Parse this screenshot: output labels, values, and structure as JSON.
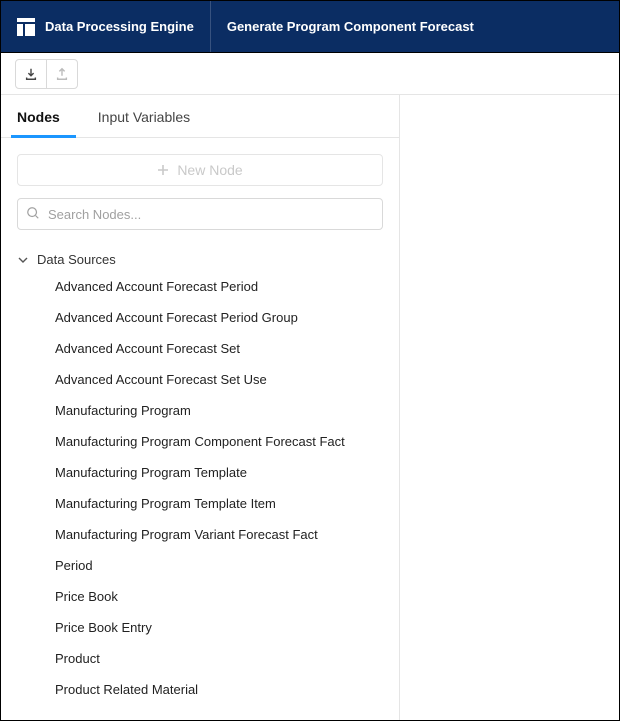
{
  "header": {
    "app_name": "Data Processing Engine",
    "page_title": "Generate Program Component Forecast"
  },
  "tabs": [
    {
      "label": "Nodes",
      "active": true
    },
    {
      "label": "Input Variables",
      "active": false
    }
  ],
  "new_node_label": "New Node",
  "search": {
    "placeholder": "Search Nodes..."
  },
  "tree": {
    "group_label": "Data Sources",
    "items": [
      "Advanced Account Forecast Period",
      "Advanced Account Forecast Period Group",
      "Advanced Account Forecast Set",
      "Advanced Account Forecast Set Use",
      "Manufacturing Program",
      "Manufacturing Program Component Forecast Fact",
      "Manufacturing Program Template",
      "Manufacturing Program Template Item",
      "Manufacturing Program Variant Forecast Fact",
      "Period",
      "Price Book",
      "Price Book Entry",
      "Product",
      "Product Related Material"
    ]
  }
}
